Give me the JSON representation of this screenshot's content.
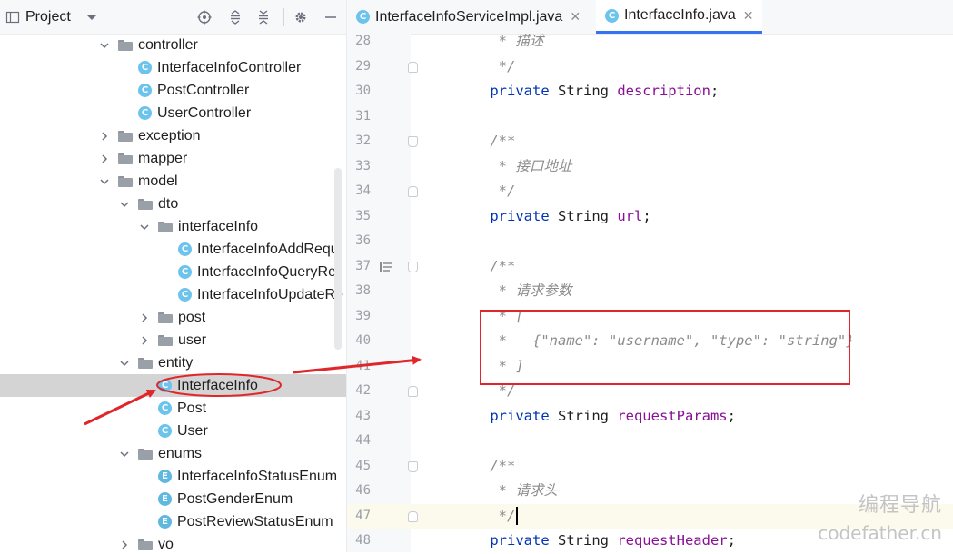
{
  "project_panel": {
    "title": "Project",
    "toolbar_icons": [
      "project-view-icon",
      "chevron-down-icon",
      "locate-icon",
      "expand-all-icon",
      "collapse-all-icon",
      "gear-icon",
      "minimize-icon"
    ],
    "tree": [
      {
        "label": "controller",
        "kind": "folder",
        "depth": 0,
        "expanded": true
      },
      {
        "label": "InterfaceInfoController",
        "kind": "class",
        "depth": 1
      },
      {
        "label": "PostController",
        "kind": "class",
        "depth": 1
      },
      {
        "label": "UserController",
        "kind": "class",
        "depth": 1
      },
      {
        "label": "exception",
        "kind": "folder",
        "depth": 0,
        "expanded": false
      },
      {
        "label": "mapper",
        "kind": "folder",
        "depth": 0,
        "expanded": false
      },
      {
        "label": "model",
        "kind": "folder",
        "depth": 0,
        "expanded": true
      },
      {
        "label": "dto",
        "kind": "folder",
        "depth": 1,
        "expanded": true
      },
      {
        "label": "interfaceInfo",
        "kind": "folder",
        "depth": 2,
        "expanded": true
      },
      {
        "label": "InterfaceInfoAddRequ",
        "kind": "class",
        "depth": 3
      },
      {
        "label": "InterfaceInfoQueryRe",
        "kind": "class",
        "depth": 3
      },
      {
        "label": "InterfaceInfoUpdateRe",
        "kind": "class",
        "depth": 3
      },
      {
        "label": "post",
        "kind": "folder",
        "depth": 2,
        "expanded": false
      },
      {
        "label": "user",
        "kind": "folder",
        "depth": 2,
        "expanded": false
      },
      {
        "label": "entity",
        "kind": "folder",
        "depth": 1,
        "expanded": true
      },
      {
        "label": "InterfaceInfo",
        "kind": "class",
        "depth": 2,
        "selected": true
      },
      {
        "label": "Post",
        "kind": "class",
        "depth": 2
      },
      {
        "label": "User",
        "kind": "class",
        "depth": 2
      },
      {
        "label": "enums",
        "kind": "folder",
        "depth": 1,
        "expanded": true
      },
      {
        "label": "InterfaceInfoStatusEnum",
        "kind": "enum",
        "depth": 2
      },
      {
        "label": "PostGenderEnum",
        "kind": "enum",
        "depth": 2
      },
      {
        "label": "PostReviewStatusEnum",
        "kind": "enum",
        "depth": 2
      },
      {
        "label": "vo",
        "kind": "folder",
        "depth": 1,
        "expanded": false
      }
    ]
  },
  "editor": {
    "tabs": [
      {
        "label": "InterfaceInfoServiceImpl.java",
        "active": false
      },
      {
        "label": "InterfaceInfo.java",
        "active": true
      }
    ],
    "lines": [
      {
        "num": "28",
        "tokens": [
          {
            "t": "     * 描述",
            "c": "doc"
          }
        ]
      },
      {
        "num": "29",
        "fold": "end",
        "tokens": [
          {
            "t": "     */",
            "c": "doc"
          }
        ]
      },
      {
        "num": "30",
        "tokens": [
          {
            "t": "    ",
            "c": "ty"
          },
          {
            "t": "private",
            "c": "kw"
          },
          {
            "t": " String ",
            "c": "ty"
          },
          {
            "t": "description",
            "c": "fld"
          },
          {
            "t": ";",
            "c": "ty"
          }
        ]
      },
      {
        "num": "31",
        "tokens": []
      },
      {
        "num": "32",
        "fold": "start",
        "tokens": [
          {
            "t": "    /**",
            "c": "doc"
          }
        ]
      },
      {
        "num": "33",
        "tokens": [
          {
            "t": "     * 接口地址",
            "c": "doc"
          }
        ]
      },
      {
        "num": "34",
        "fold": "end",
        "tokens": [
          {
            "t": "     */",
            "c": "doc"
          }
        ]
      },
      {
        "num": "35",
        "tokens": [
          {
            "t": "    ",
            "c": "ty"
          },
          {
            "t": "private",
            "c": "kw"
          },
          {
            "t": " String ",
            "c": "ty"
          },
          {
            "t": "url",
            "c": "fld"
          },
          {
            "t": ";",
            "c": "ty"
          }
        ]
      },
      {
        "num": "36",
        "tokens": []
      },
      {
        "num": "37",
        "fold": "start",
        "doc_icon": true,
        "tokens": [
          {
            "t": "    /**",
            "c": "doc"
          }
        ]
      },
      {
        "num": "38",
        "tokens": [
          {
            "t": "     * 请求参数",
            "c": "doc"
          }
        ]
      },
      {
        "num": "39",
        "tokens": [
          {
            "t": "     * [",
            "c": "doc"
          }
        ]
      },
      {
        "num": "40",
        "tokens": [
          {
            "t": "     *   {\"name\": \"username\", \"type\": \"string\"}",
            "c": "doc"
          }
        ]
      },
      {
        "num": "41",
        "tokens": [
          {
            "t": "     * ]",
            "c": "doc"
          }
        ]
      },
      {
        "num": "42",
        "fold": "end",
        "tokens": [
          {
            "t": "     */",
            "c": "doc"
          }
        ]
      },
      {
        "num": "43",
        "tokens": [
          {
            "t": "    ",
            "c": "ty"
          },
          {
            "t": "private",
            "c": "kw"
          },
          {
            "t": " String ",
            "c": "ty"
          },
          {
            "t": "requestParams",
            "c": "fld"
          },
          {
            "t": ";",
            "c": "ty"
          }
        ]
      },
      {
        "num": "44",
        "tokens": []
      },
      {
        "num": "45",
        "fold": "start",
        "tokens": [
          {
            "t": "    /**",
            "c": "doc"
          }
        ]
      },
      {
        "num": "46",
        "tokens": [
          {
            "t": "     * 请求头",
            "c": "doc"
          }
        ]
      },
      {
        "num": "47",
        "fold": "end",
        "current": true,
        "tokens": [
          {
            "t": "     */",
            "c": "doc"
          }
        ]
      },
      {
        "num": "48",
        "tokens": [
          {
            "t": "    ",
            "c": "ty"
          },
          {
            "t": "private",
            "c": "kw"
          },
          {
            "t": " String ",
            "c": "ty"
          },
          {
            "t": "requestHeader",
            "c": "fld"
          },
          {
            "t": ";",
            "c": "ty"
          }
        ]
      }
    ]
  },
  "watermark": {
    "line1": "编程导航",
    "line2": "codefather.cn"
  },
  "colors": {
    "annotation_red": "#e0262b",
    "keyword": "#0033b3",
    "field": "#871094",
    "comment": "#8c8c8c",
    "accent": "#3574f0"
  }
}
